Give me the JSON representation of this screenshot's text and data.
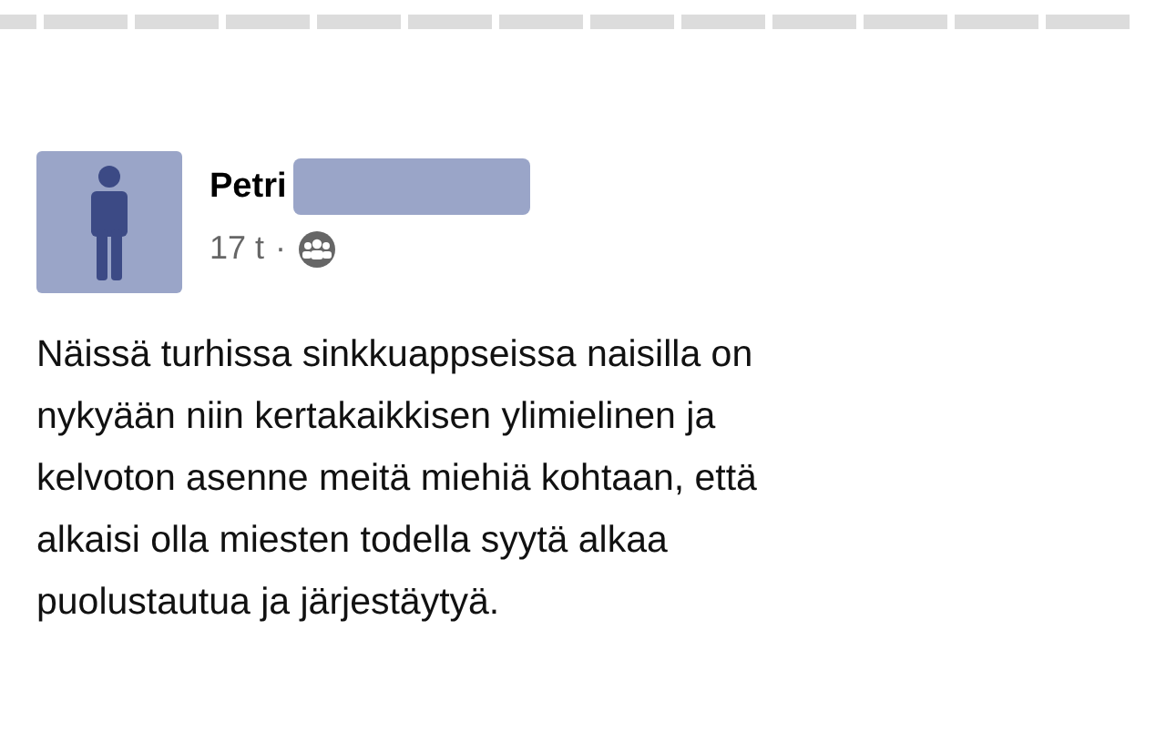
{
  "post": {
    "author": "Petri",
    "author_redacted": true,
    "time": "17 t",
    "separator": "·",
    "text": "Näissä turhissa sinkkuappseissa naisilla on\nnykyään niin kertakaikkisen ylimielinen ja\nkelvoton asenne meitä miehiä kohtaan, että\nalkaisi olla miesten todella syytä alkaa\npuolustautua ja järjestäytyä."
  }
}
